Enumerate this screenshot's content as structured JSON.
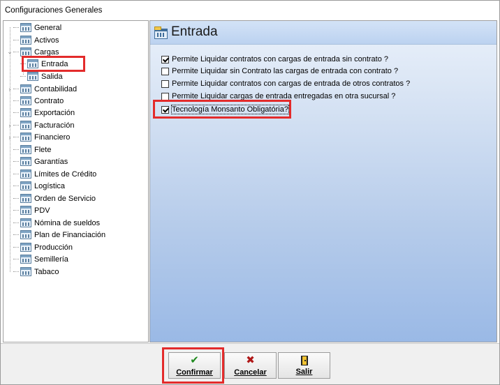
{
  "window": {
    "title": "Configuraciones Generales"
  },
  "tree": {
    "items": [
      {
        "label": "General",
        "expander": ""
      },
      {
        "label": "Activos",
        "expander": ""
      },
      {
        "label": "Cargas",
        "expander": "⌄"
      },
      {
        "label": "Entrada",
        "expander": ""
      },
      {
        "label": "Salida",
        "expander": ""
      },
      {
        "label": "Contabilidad",
        "expander": "›"
      },
      {
        "label": "Contrato",
        "expander": ""
      },
      {
        "label": "Exportación",
        "expander": ""
      },
      {
        "label": "Facturación",
        "expander": "›"
      },
      {
        "label": "Financiero",
        "expander": "›"
      },
      {
        "label": "Flete",
        "expander": ""
      },
      {
        "label": "Garantías",
        "expander": ""
      },
      {
        "label": "Límites de Crédito",
        "expander": ""
      },
      {
        "label": "Logística",
        "expander": ""
      },
      {
        "label": "Orden de Servicio",
        "expander": ""
      },
      {
        "label": "PDV",
        "expander": ""
      },
      {
        "label": "Nómina de sueldos",
        "expander": ""
      },
      {
        "label": "Plan de Financiación",
        "expander": ""
      },
      {
        "label": "Producción",
        "expander": ""
      },
      {
        "label": "Semillería",
        "expander": ""
      },
      {
        "label": "Tabaco",
        "expander": ""
      }
    ],
    "selected": "Entrada"
  },
  "panel": {
    "heading": "Entrada",
    "options": [
      {
        "label": "Permite Liquidar contratos con cargas de entrada sin contrato ?",
        "checked": true
      },
      {
        "label": "Permite Liquidar sin Contrato las cargas de entrada con contrato ?",
        "checked": false
      },
      {
        "label": "Permite Liquidar contratos con cargas de entrada de otros contratos ?",
        "checked": false
      },
      {
        "label": "Permite Liquidar cargas de entrada entregadas en otra sucursal ?",
        "checked": false
      },
      {
        "label": "Tecnología Monsanto Obligatória?",
        "checked": true
      }
    ]
  },
  "buttons": {
    "confirm": {
      "label": "Confirmar",
      "icon": "checkmark-icon"
    },
    "cancel": {
      "label": "Cancelar",
      "icon": "x-icon"
    },
    "exit": {
      "label": "Salir",
      "icon": "door-exit-icon"
    }
  },
  "colors": {
    "highlight": "#e32b2b",
    "panel_gradient_end": "#9ab9e6"
  }
}
